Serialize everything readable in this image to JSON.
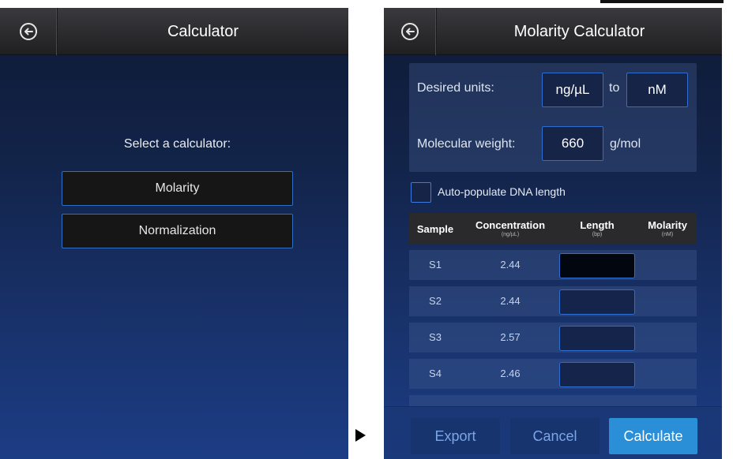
{
  "calculator_screen": {
    "title": "Calculator",
    "select_label": "Select a calculator:",
    "options": [
      "Molarity",
      "Normalization"
    ]
  },
  "molarity_screen": {
    "title": "Molarity Calculator",
    "desired_units_label": "Desired units:",
    "from_unit": "ng/µL",
    "to_label": "to",
    "to_unit": "nM",
    "molecular_weight_label": "Molecular weight:",
    "molecular_weight_value": "660",
    "molecular_weight_unit": "g/mol",
    "auto_populate_label": "Auto-populate DNA length",
    "auto_populate_checked": false,
    "table": {
      "headers": [
        {
          "label": "Sample",
          "unit": ""
        },
        {
          "label": "Concentration",
          "unit": "(ng/µL)"
        },
        {
          "label": "Length",
          "unit": "(bp)"
        },
        {
          "label": "Molarity",
          "unit": "(nM)"
        }
      ],
      "rows": [
        {
          "sample": "S1",
          "concentration": "2.44",
          "length": "",
          "molarity": ""
        },
        {
          "sample": "S2",
          "concentration": "2.44",
          "length": "",
          "molarity": ""
        },
        {
          "sample": "S3",
          "concentration": "2.57",
          "length": "",
          "molarity": ""
        },
        {
          "sample": "S4",
          "concentration": "2.46",
          "length": "",
          "molarity": ""
        }
      ]
    },
    "buttons": {
      "export": "Export",
      "cancel": "Cancel",
      "calculate": "Calculate"
    }
  },
  "colors": {
    "accent_border": "#2d6ed0",
    "primary_button": "#2a8fd6",
    "titlebar": "#2a2a2d"
  },
  "icons": {
    "back": "back-arrow-circle-icon",
    "transition": "right-triangle-arrow-icon"
  }
}
